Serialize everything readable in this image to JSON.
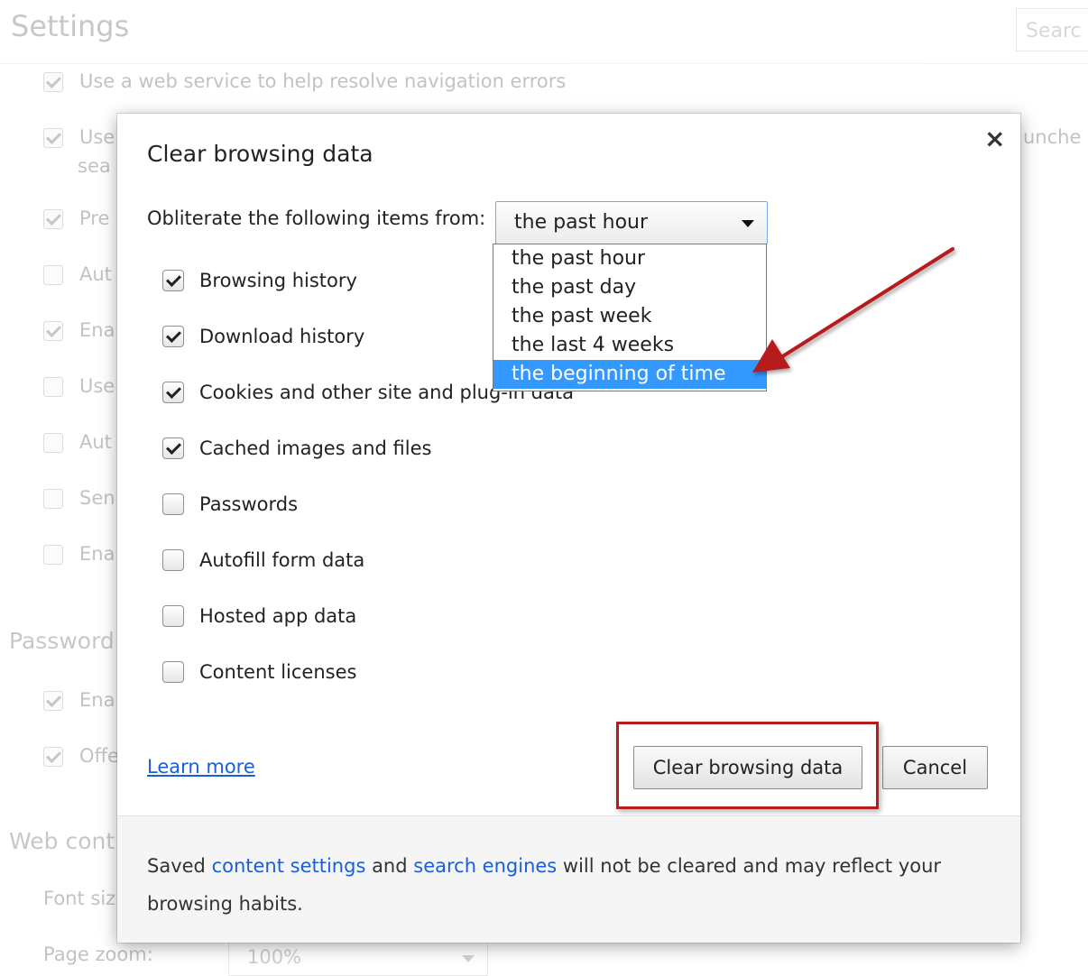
{
  "background": {
    "title": "Settings",
    "search_placeholder": "Searc",
    "rows": [
      {
        "text": "Use a web service to help resolve navigation errors",
        "checked": true
      },
      {
        "text": "Use",
        "checked": true
      },
      {
        "text": "Pre",
        "checked": true
      },
      {
        "text": "Aut",
        "checked": false
      },
      {
        "text": "Ena",
        "checked": true
      },
      {
        "text": "Use",
        "checked": false
      },
      {
        "text": "Aut",
        "checked": false
      },
      {
        "text": "Sen",
        "checked": false
      },
      {
        "text": "Ena",
        "checked": false
      }
    ],
    "row_continuation_left": "sea",
    "row_continuation_right": "unche",
    "section_passwords": "Password",
    "password_rows": [
      {
        "text": "Ena",
        "checked": true
      },
      {
        "text": "Offe",
        "checked": true
      }
    ],
    "section_web": "Web cont",
    "font_size_label": "Font siz",
    "page_zoom_label": "Page zoom:",
    "page_zoom_value": "100%"
  },
  "dialog": {
    "title": "Clear browsing data",
    "close_symbol": "×",
    "from_label": "Obliterate the following items from:",
    "selected_range": "the past hour",
    "range_options": [
      "the past hour",
      "the past day",
      "the past week",
      "the last 4 weeks",
      "the beginning of time"
    ],
    "highlighted_option_index": 4,
    "items": [
      {
        "label": "Browsing history",
        "checked": true
      },
      {
        "label": "Download history",
        "checked": true
      },
      {
        "label": "Cookies and other site and plug-in data",
        "checked": true
      },
      {
        "label": "Cached images and files",
        "checked": true
      },
      {
        "label": "Passwords",
        "checked": false
      },
      {
        "label": "Autofill form data",
        "checked": false
      },
      {
        "label": "Hosted app data",
        "checked": false
      },
      {
        "label": "Content licenses",
        "checked": false
      }
    ],
    "learn_more": "Learn more",
    "clear_button": "Clear browsing data",
    "cancel_button": "Cancel",
    "footer": {
      "part1": "Saved ",
      "link1": "content settings",
      "part2": " and ",
      "link2": "search engines",
      "part3": " will not be cleared and may reflect your browsing habits."
    }
  },
  "colors": {
    "accent_highlight": "#3399ff",
    "annotation_red": "#b71c1c",
    "link": "#1a5fd6"
  }
}
